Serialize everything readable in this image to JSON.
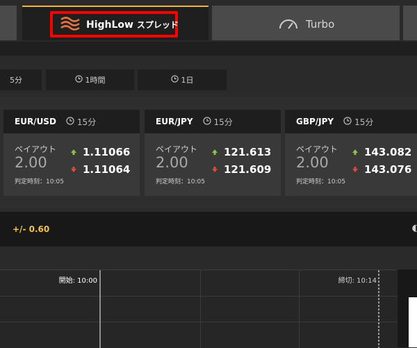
{
  "tabs": {
    "highlow_label": "HighLow",
    "highlow_suffix": "スプレッド",
    "turbo_label": "Turbo"
  },
  "time_filters": [
    {
      "label": "5分"
    },
    {
      "label": "1時間"
    },
    {
      "label": "1日"
    }
  ],
  "cards": [
    {
      "pair": "EUR/USD",
      "duration": "15分",
      "payout_label": "ペイアウト",
      "payout": "2.00",
      "high": "1.11066",
      "low": "1.11064",
      "judge": "判定時刻：10:05"
    },
    {
      "pair": "EUR/JPY",
      "duration": "15分",
      "payout_label": "ペイアウト",
      "payout": "2.00",
      "high": "121.613",
      "low": "121.609",
      "judge": "判定時刻：10:05"
    },
    {
      "pair": "GBP/JPY",
      "duration": "15分",
      "payout_label": "ペイアウト",
      "payout": "2.00",
      "high": "143.082",
      "low": "143.076",
      "judge": "判定時刻：10:05"
    }
  ],
  "spread": "+/- 0.60",
  "chart": {
    "start_label": "開始: 10:00",
    "end_label": "締切: 10:14"
  },
  "colors": {
    "accent": "#f1b633",
    "up": "#8bc34a",
    "down": "#e04a3a",
    "highlight_box": "#ff0000"
  }
}
